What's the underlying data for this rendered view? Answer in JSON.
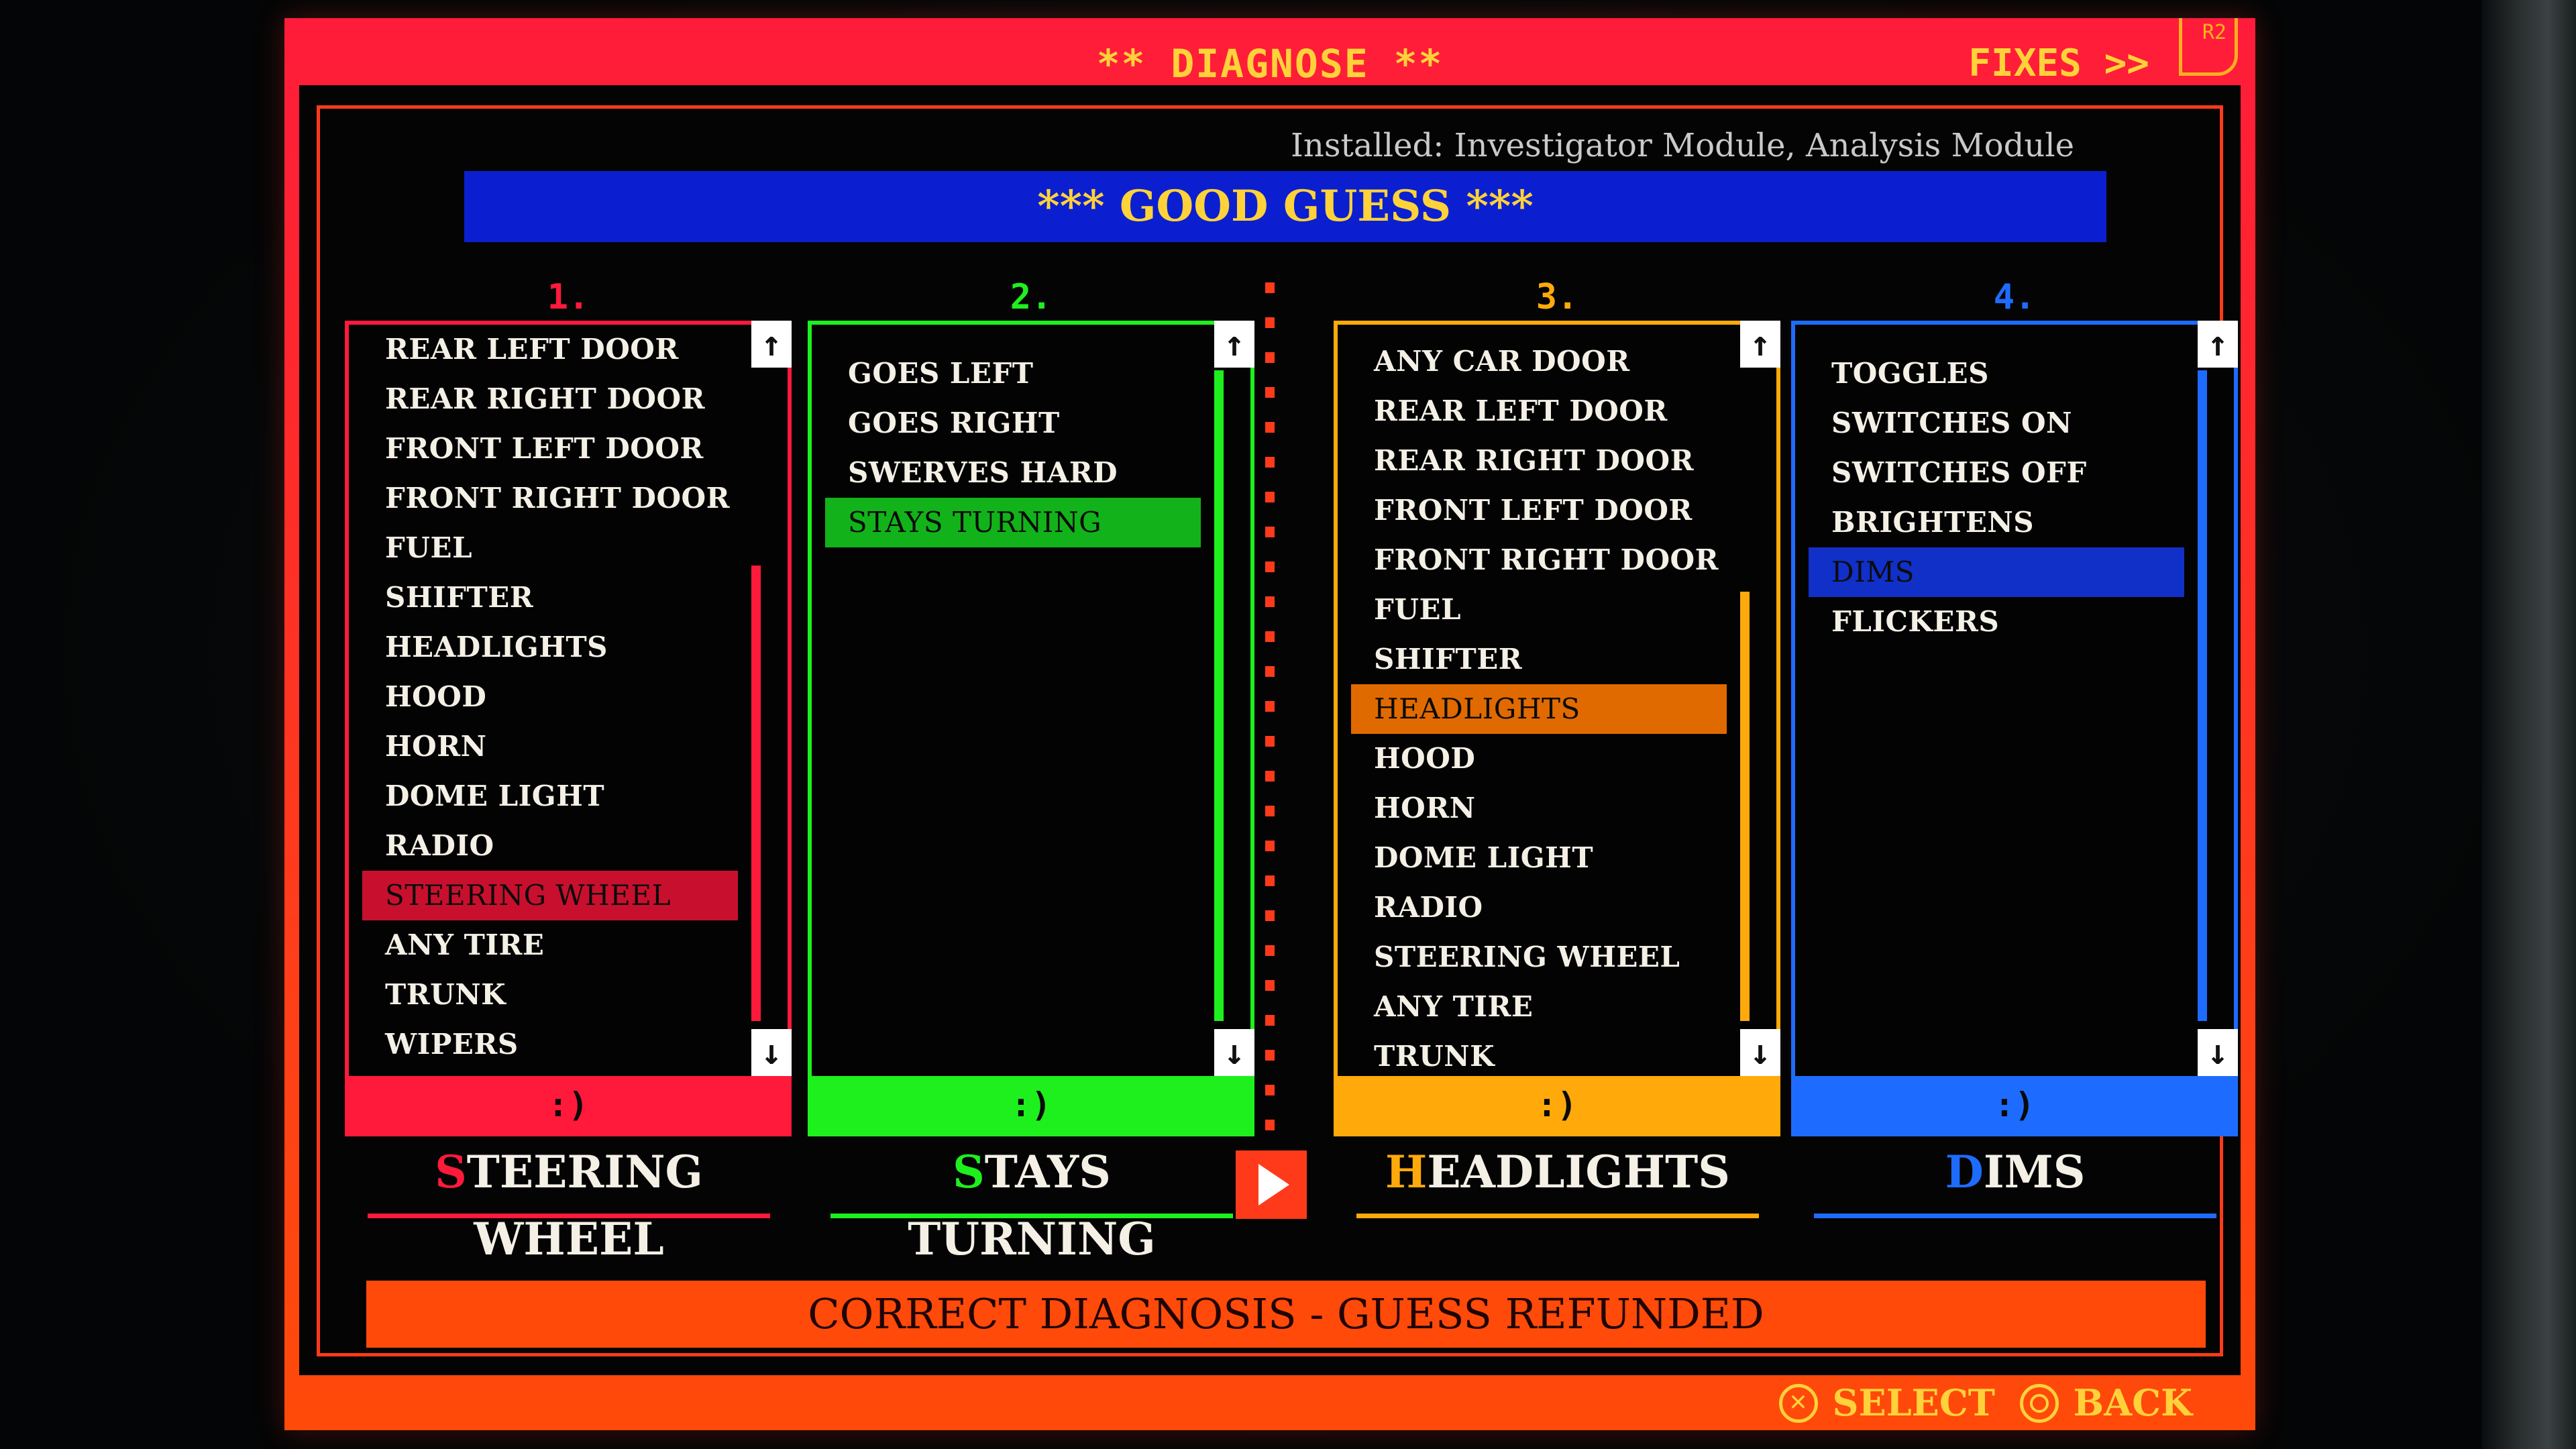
{
  "header": {
    "title": "** DIAGNOSE **",
    "fixes_label": "FIXES >>",
    "fixes_button_hint": "R2"
  },
  "installed_text": "Installed: Investigator Module, Analysis Module",
  "banner": "*** GOOD GUESS ***",
  "columns": [
    {
      "number": "1.",
      "color": "#ff1a3c",
      "highlight": "#c8102e",
      "items": [
        "REAR LEFT DOOR",
        "REAR RIGHT DOOR",
        "FRONT LEFT DOOR",
        "FRONT RIGHT DOOR",
        "FUEL",
        "SHIFTER",
        "HEADLIGHTS",
        "HOOD",
        "HORN",
        "DOME LIGHT",
        "RADIO",
        "STEERING WHEEL",
        "ANY TIRE",
        "TRUNK",
        "WIPERS"
      ],
      "selected_index": 11,
      "scroll_position": 0.3,
      "scroll_visible": 0.7,
      "footer": ":)",
      "selection": "STEERING WHEEL"
    },
    {
      "number": "2.",
      "color": "#1ef01e",
      "highlight": "#12b21a",
      "items": [
        "GOES LEFT",
        "GOES RIGHT",
        "SWERVES HARD",
        "STAYS TURNING"
      ],
      "selected_index": 3,
      "scroll_position": 0.0,
      "scroll_visible": 1.0,
      "footer": ":)",
      "selection": "STAYS TURNING"
    },
    {
      "number": "3.",
      "color": "#ffaa0a",
      "highlight": "#e06a00",
      "items": [
        "ANY CAR DOOR",
        "REAR LEFT DOOR",
        "REAR RIGHT DOOR",
        "FRONT LEFT DOOR",
        "FRONT RIGHT DOOR",
        "FUEL",
        "SHIFTER",
        "HEADLIGHTS",
        "HOOD",
        "HORN",
        "DOME LIGHT",
        "RADIO",
        "STEERING WHEEL",
        "ANY TIRE",
        "TRUNK"
      ],
      "selected_index": 7,
      "scroll_position": 0.34,
      "scroll_visible": 0.66,
      "footer": ":)",
      "selection": "HEADLIGHTS"
    },
    {
      "number": "4.",
      "color": "#1e6cff",
      "highlight": "#1030c8",
      "items": [
        "TOGGLES",
        "SWITCHES ON",
        "SWITCHES OFF",
        "BRIGHTENS",
        "DIMS",
        "FLICKERS"
      ],
      "selected_index": 4,
      "scroll_position": 0.0,
      "scroll_visible": 1.0,
      "footer": ":)",
      "selection": "DIMS"
    }
  ],
  "result": "CORRECT DIAGNOSIS - GUESS REFUNDED",
  "controls": {
    "select_label": "SELECT",
    "select_icon": "cross-button-icon",
    "back_label": "BACK",
    "back_icon": "circle-button-icon"
  }
}
